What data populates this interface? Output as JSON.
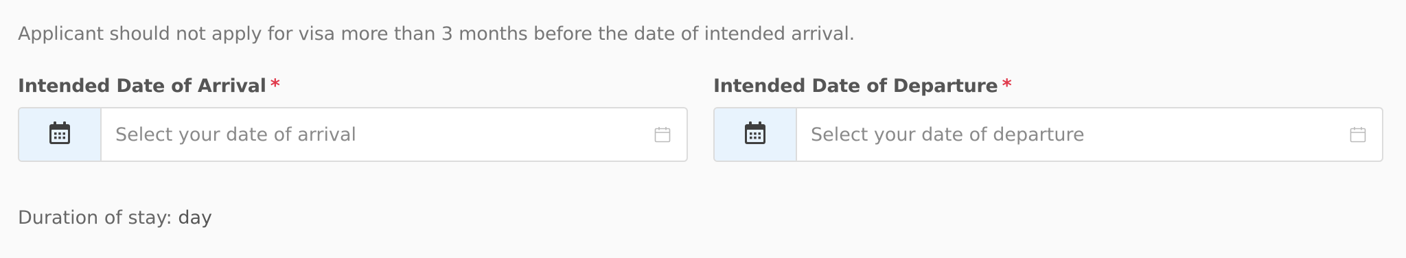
{
  "notice": "Applicant should not apply for visa more than 3 months before the date of intended arrival.",
  "arrival": {
    "label": "Intended Date of Arrival",
    "required_mark": "*",
    "placeholder": "Select your date of arrival",
    "value": "",
    "icon": "calendar-icon",
    "trailing_icon": "calendar-outline-icon"
  },
  "departure": {
    "label": "Intended Date of Departure",
    "required_mark": "*",
    "placeholder": "Select your date of departure",
    "value": "",
    "icon": "calendar-icon",
    "trailing_icon": "calendar-outline-icon"
  },
  "duration": {
    "label": "Duration of stay:",
    "unit": "day"
  },
  "colors": {
    "required": "#e0384a",
    "addon_bg": "#e8f3fd",
    "border": "#dcdcdc"
  }
}
